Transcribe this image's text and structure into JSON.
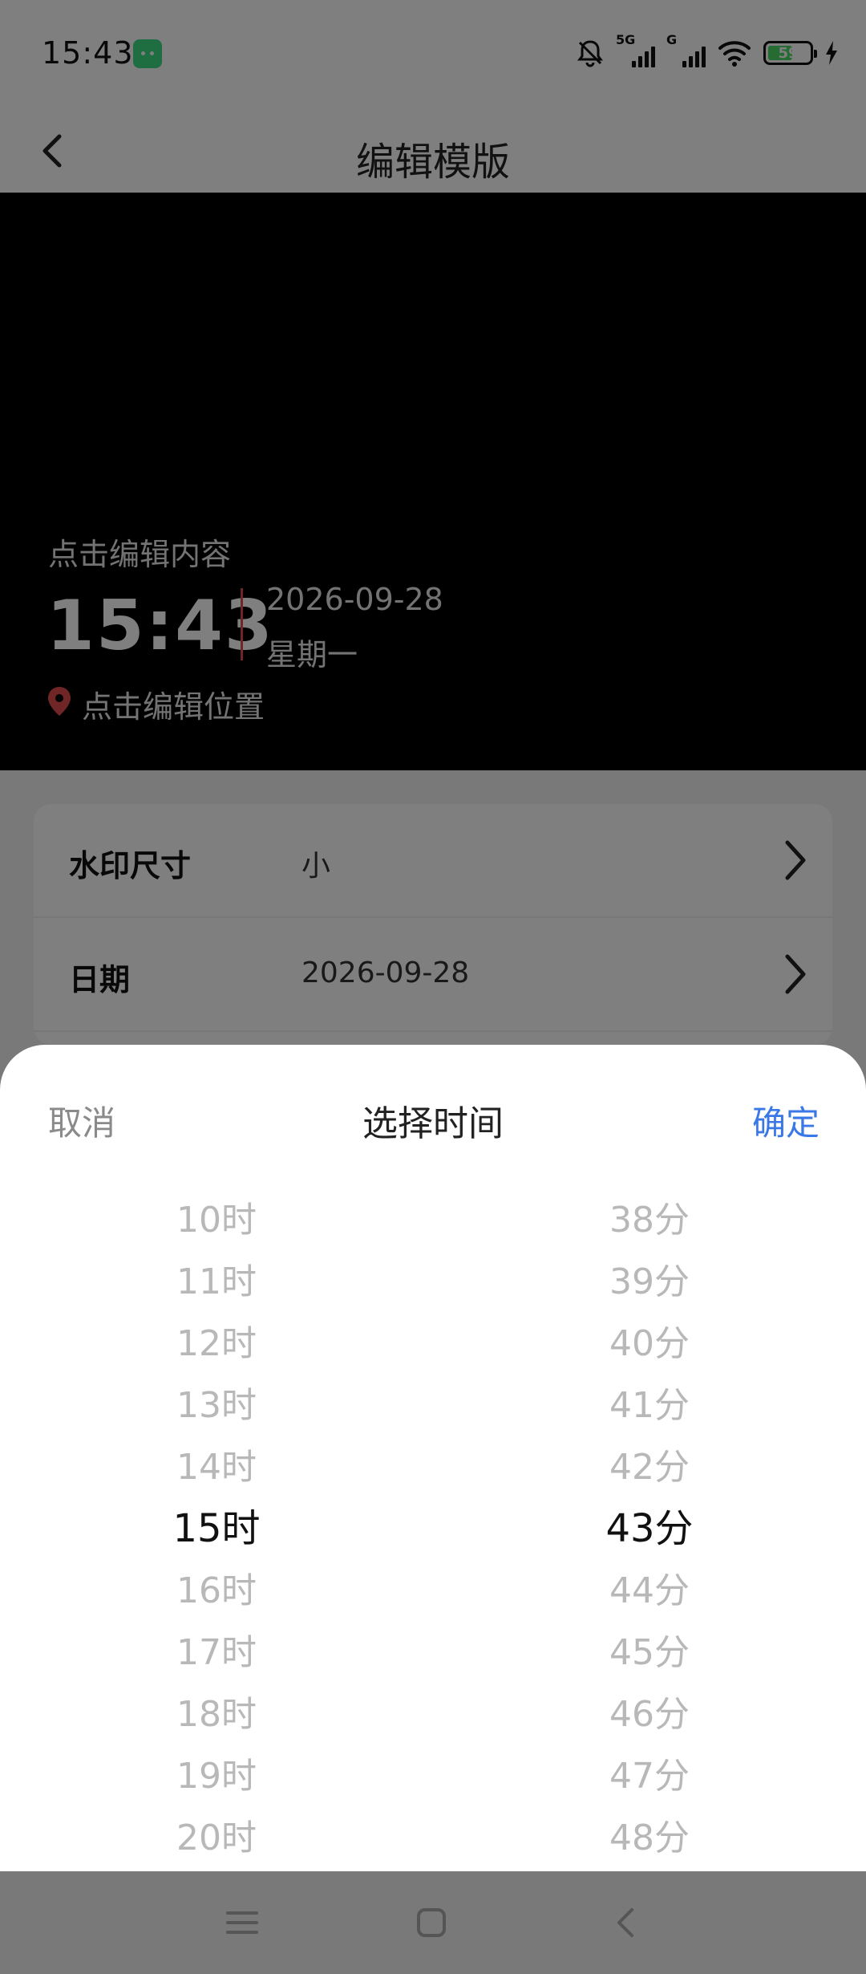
{
  "status_bar": {
    "time": "15:43",
    "network_1": "5G",
    "network_2": "G",
    "battery": "59",
    "battery_level": 0.59
  },
  "header": {
    "title": "编辑模版"
  },
  "preview": {
    "content_hint": "点击编辑内容",
    "time": "15:43",
    "date": "2026-09-28",
    "weekday": "星期一",
    "location_hint": "点击编辑位置"
  },
  "settings": {
    "rows": [
      {
        "label": "水印尺寸",
        "value": "小"
      },
      {
        "label": "日期",
        "value": "2026-09-28"
      }
    ]
  },
  "time_picker": {
    "cancel": "取消",
    "title": "选择时间",
    "confirm": "确定",
    "hours": [
      "10时",
      "11时",
      "12时",
      "13时",
      "14时",
      "15时",
      "16时",
      "17时",
      "18时",
      "19时",
      "20时"
    ],
    "minutes": [
      "38分",
      "39分",
      "40分",
      "41分",
      "42分",
      "43分",
      "44分",
      "45分",
      "46分",
      "47分",
      "48分"
    ],
    "selected_hour": "15时",
    "selected_minute": "43分"
  },
  "colors": {
    "accent": "#3b78e7",
    "divider_red": "#e14c4c",
    "battery_green": "#4cd964"
  },
  "icons": [
    "mute-icon",
    "wifi-icon",
    "charge-icon",
    "back-icon",
    "location-icon",
    "chevron-right-icon",
    "menu-icon",
    "home-icon",
    "nav-back-icon"
  ]
}
